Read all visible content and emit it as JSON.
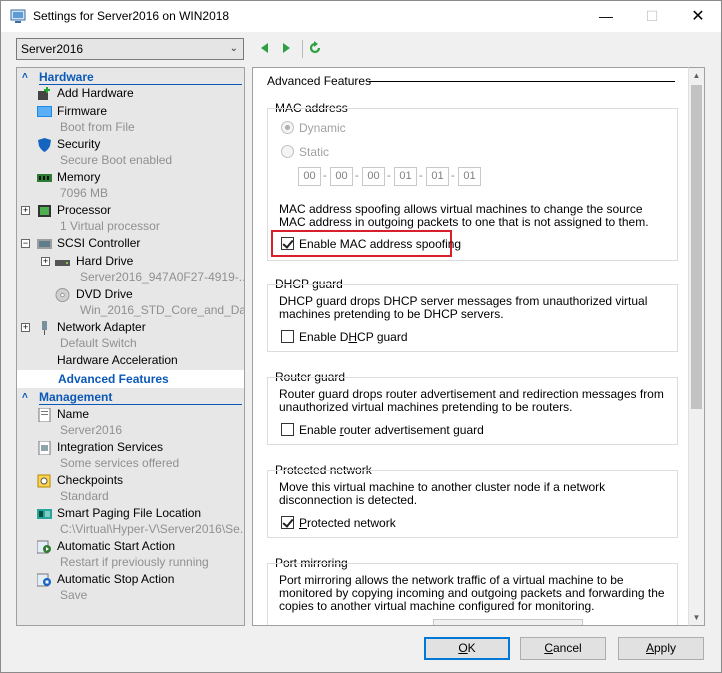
{
  "window": {
    "title": "Settings for Server2016 on WIN2018",
    "minimize_glyph": "—",
    "maximize_glyph": "☐",
    "close_glyph": "✕"
  },
  "toolbar": {
    "vm_selected": "Server2016",
    "icons": [
      "back-arrow-icon",
      "forward-arrow-icon",
      "refresh-icon"
    ]
  },
  "tree": {
    "hardware_header": "Hardware",
    "management_header": "Management",
    "hardware_items": [
      {
        "name": "Add Hardware",
        "sub": ""
      },
      {
        "name": "Firmware",
        "sub": "Boot from File"
      },
      {
        "name": "Security",
        "sub": "Secure Boot enabled"
      },
      {
        "name": "Memory",
        "sub": "7096 MB"
      },
      {
        "name": "Processor",
        "sub": "1 Virtual processor"
      },
      {
        "name": "SCSI Controller",
        "sub": ""
      },
      {
        "name": "Hard Drive",
        "sub": "Server2016_947A0F27-4919-..."
      },
      {
        "name": "DVD Drive",
        "sub": "Win_2016_STD_Core_and_Da..."
      },
      {
        "name": "Network Adapter",
        "sub": "Default Switch"
      },
      {
        "name": "Hardware Acceleration",
        "sub": ""
      },
      {
        "name": "Advanced Features",
        "sub": ""
      }
    ],
    "management_items": [
      {
        "name": "Name",
        "sub": "Server2016"
      },
      {
        "name": "Integration Services",
        "sub": "Some services offered"
      },
      {
        "name": "Checkpoints",
        "sub": "Standard"
      },
      {
        "name": "Smart Paging File Location",
        "sub": "C:\\Virtual\\Hyper-V\\Server2016\\Se..."
      },
      {
        "name": "Automatic Start Action",
        "sub": "Restart if previously running"
      },
      {
        "name": "Automatic Stop Action",
        "sub": "Save"
      }
    ]
  },
  "pane": {
    "title": "Advanced Features",
    "mac": {
      "title": "MAC address",
      "dynamic_label": "Dynamic",
      "static_label": "Static",
      "octets": [
        "00",
        "00",
        "00",
        "01",
        "01",
        "01"
      ],
      "dash": "-",
      "description": "MAC address spoofing allows virtual machines to change the source MAC address in outgoing packets to one that is not assigned to them.",
      "spoofing_label": "Enable MAC address spoofing",
      "spoofing_checked": true
    },
    "dhcp": {
      "title": "DHCP guard",
      "description": "DHCP guard drops DHCP server messages from unauthorized virtual machines pretending to be DHCP servers.",
      "label_pre": "Enable D",
      "label_ul": "H",
      "label_post": "CP guard",
      "checked": false
    },
    "router": {
      "title": "Router guard",
      "description": "Router guard drops router advertisement and redirection messages from unauthorized virtual machines pretending to be routers.",
      "label_pre": "Enable ",
      "label_ul": "r",
      "label_post": "outer advertisement guard",
      "checked": false
    },
    "protected": {
      "title": "Protected network",
      "description": "Move this virtual machine to another cluster node if a network disconnection is detected.",
      "label_pre": "",
      "label_ul": "P",
      "label_post": "rotected network",
      "checked": true
    },
    "mirroring": {
      "title": "Port mirroring",
      "description": "Port mirroring allows the network traffic of a virtual machine to be monitored by copying incoming and outgoing packets and forwarding the copies to another virtual machine configured for monitoring."
    }
  },
  "buttons": {
    "ok_ul": "O",
    "ok_rest": "K",
    "cancel_ul": "C",
    "cancel_rest": "ancel",
    "apply_ul": "A",
    "apply_rest": "pply"
  },
  "colors": {
    "accent": "#0b58b8",
    "highlight_border": "#d6202a",
    "default_button_border": "#0078d7"
  }
}
